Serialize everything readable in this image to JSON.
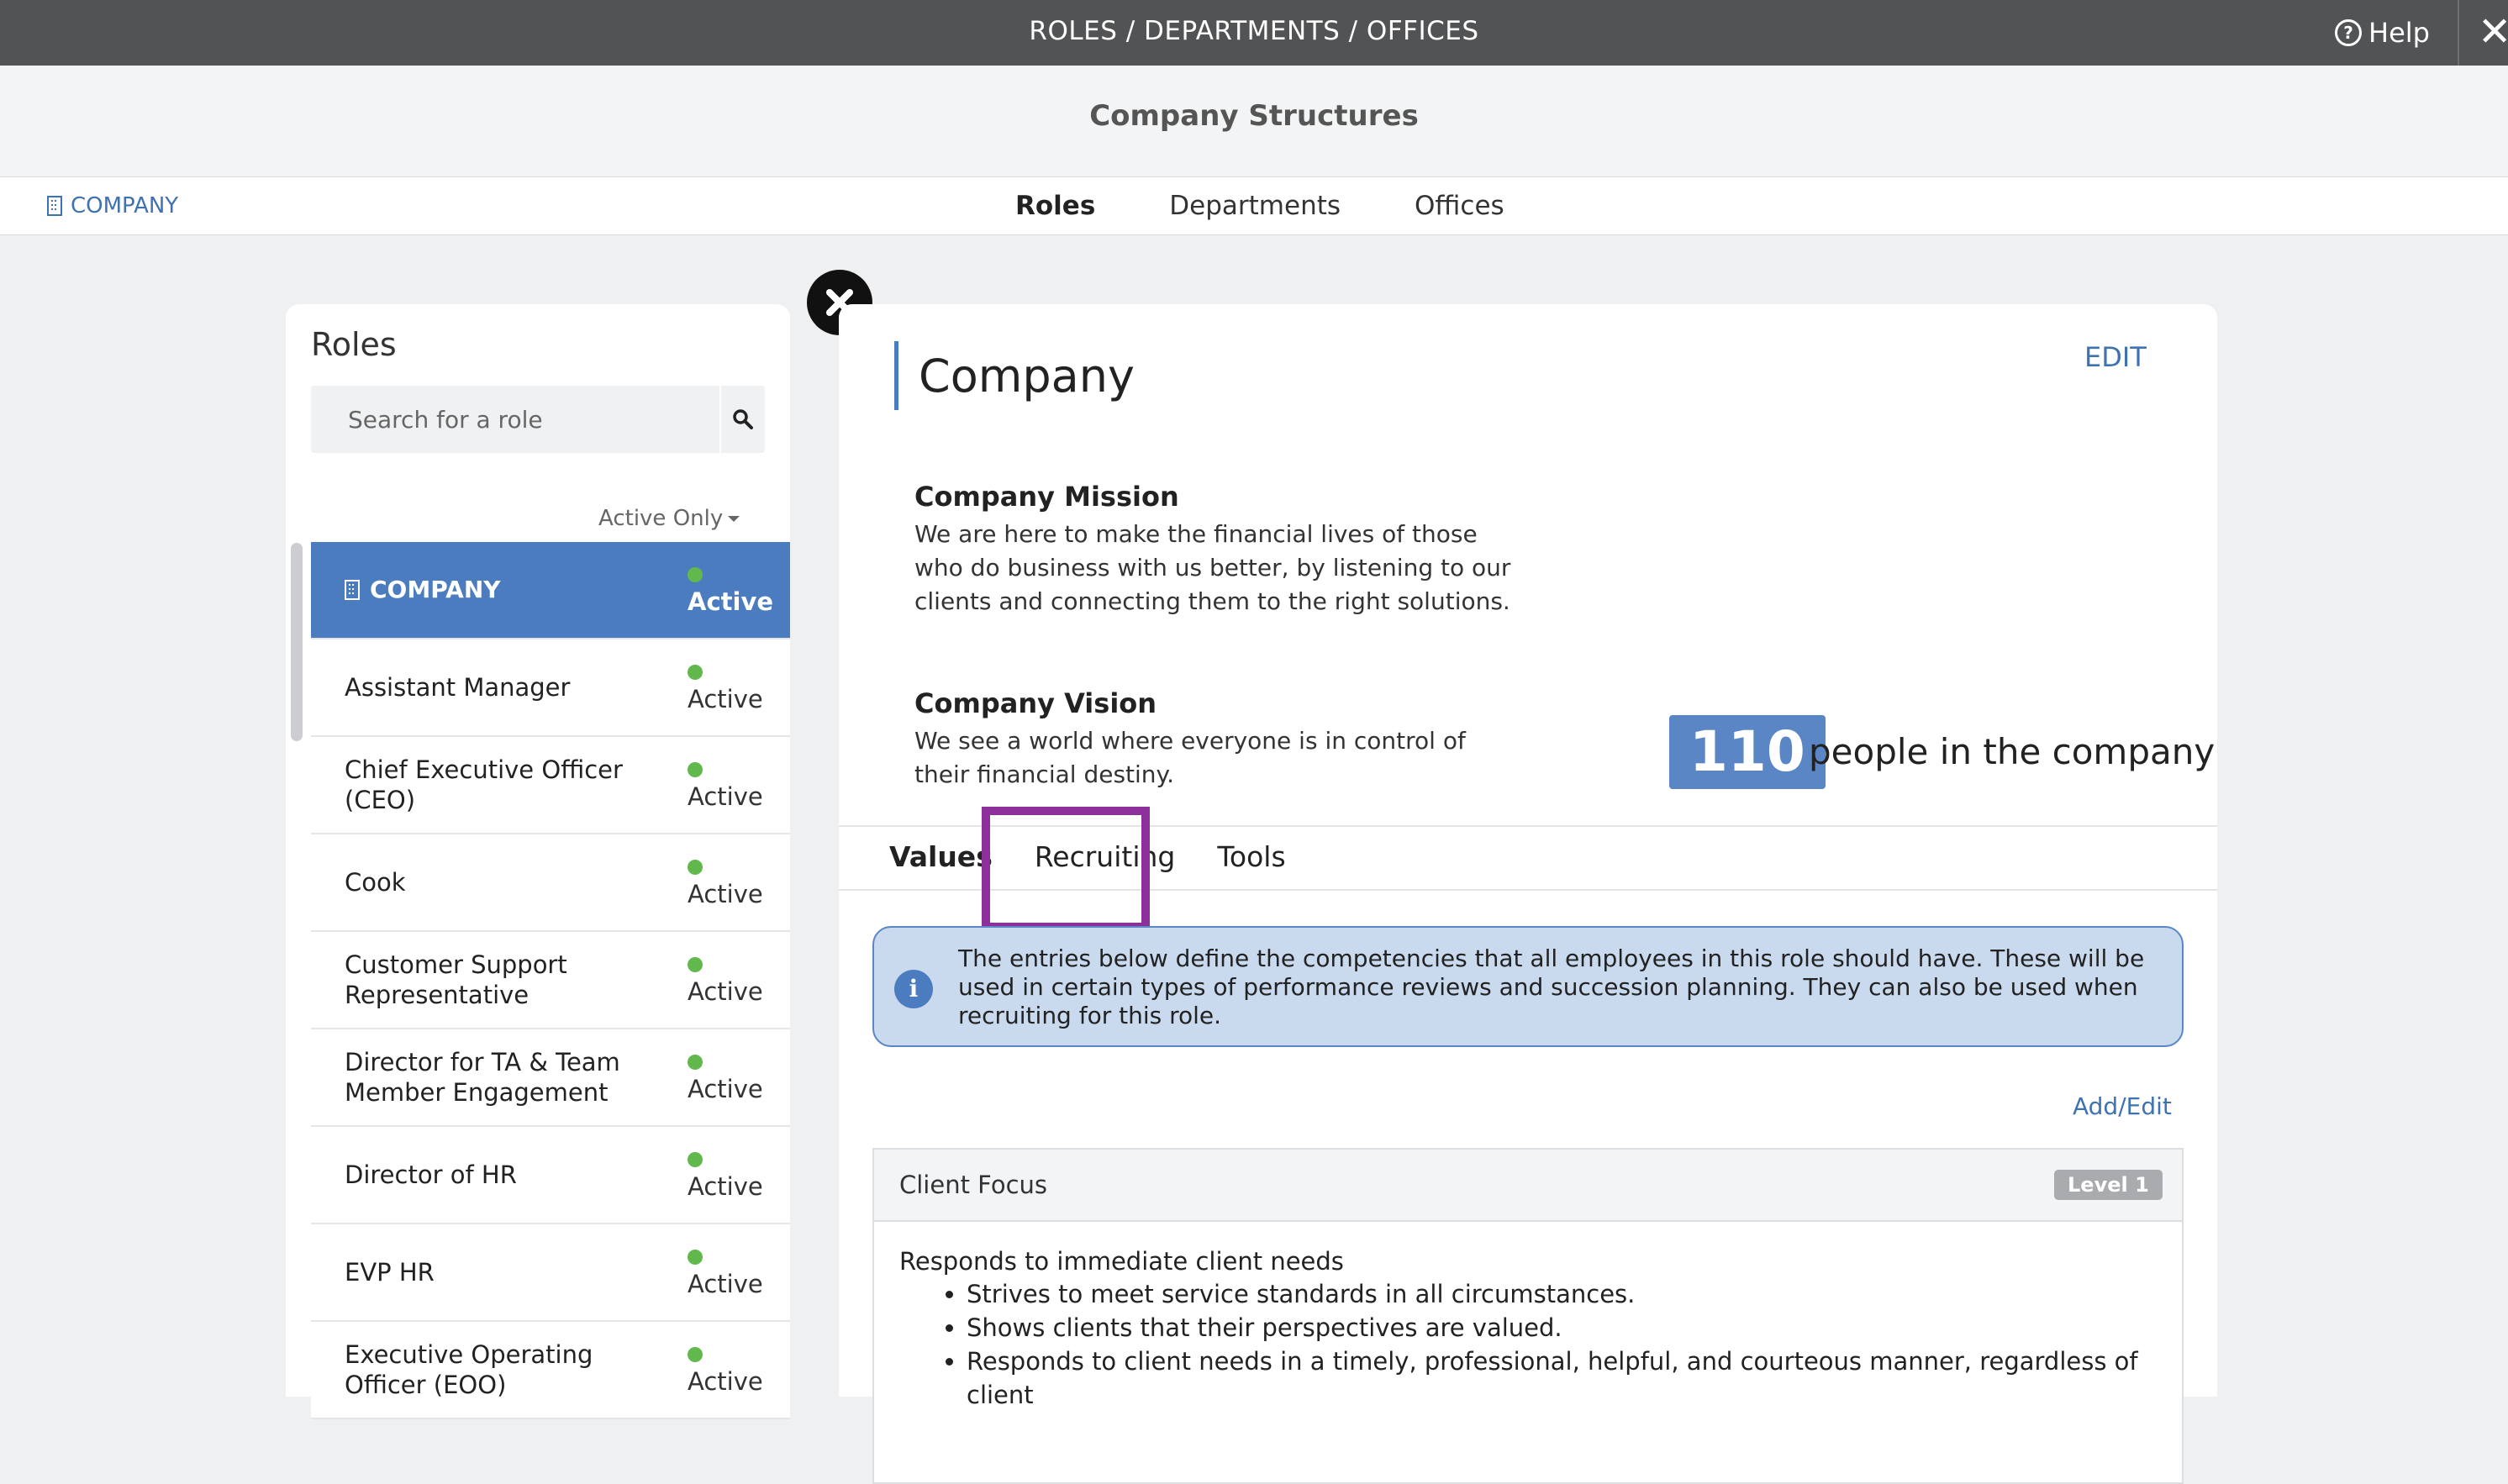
{
  "topbar": {
    "title": "ROLES / DEPARTMENTS / OFFICES",
    "help_label": "Help"
  },
  "header": {
    "title": "Company Structures"
  },
  "nav": {
    "company_link": "COMPANY",
    "tabs": [
      {
        "label": "Roles",
        "active": true
      },
      {
        "label": "Departments",
        "active": false
      },
      {
        "label": "Offices",
        "active": false
      }
    ]
  },
  "roles_panel": {
    "title": "Roles",
    "search_placeholder": "Search for a role",
    "filter_label": "Active Only",
    "items": [
      {
        "name": "COMPANY",
        "status": "Active",
        "selected": true
      },
      {
        "name": "Assistant Manager",
        "status": "Active"
      },
      {
        "name": "Chief Executive Officer (CEO)",
        "status": "Active"
      },
      {
        "name": "Cook",
        "status": "Active"
      },
      {
        "name": "Customer Support Representative",
        "status": "Active"
      },
      {
        "name": "Director for TA & Team Member Engagement",
        "status": "Active"
      },
      {
        "name": "Director of HR",
        "status": "Active"
      },
      {
        "name": "EVP HR",
        "status": "Active"
      },
      {
        "name": "Executive Operating Officer (EOO)",
        "status": "Active"
      }
    ]
  },
  "detail": {
    "title": "Company",
    "edit_label": "EDIT",
    "mission_heading": "Company Mission",
    "mission_text": "We are here to make the financial lives of those who do business with us better, by listening to our clients and connecting them to the right solutions.",
    "vision_heading": "Company Vision",
    "vision_text": "We see a world where everyone is in control of their financial destiny.",
    "people_count": "110",
    "people_label": "people in the company",
    "tabs": [
      {
        "label": "Values",
        "active": true
      },
      {
        "label": "Recruiting",
        "active": false
      },
      {
        "label": "Tools",
        "active": false
      }
    ],
    "info_text": "The entries below define the competencies that all employees in this role should have. These will be used in certain types of performance reviews and succession planning. They can also be used when recruiting for this role.",
    "addedit_label": "Add/Edit",
    "competency": {
      "name": "Client Focus",
      "level": "Level 1",
      "description": "Responds to immediate client needs",
      "bullets": [
        "Strives to meet service standards in all circumstances.",
        "Shows clients that their perspectives are valued.",
        "Responds to client needs in a timely, professional, helpful, and courteous manner, regardless of client"
      ]
    }
  },
  "colors": {
    "accent": "#4b7cbf",
    "status_active": "#61b94e",
    "highlight": "#8d2f9b"
  }
}
